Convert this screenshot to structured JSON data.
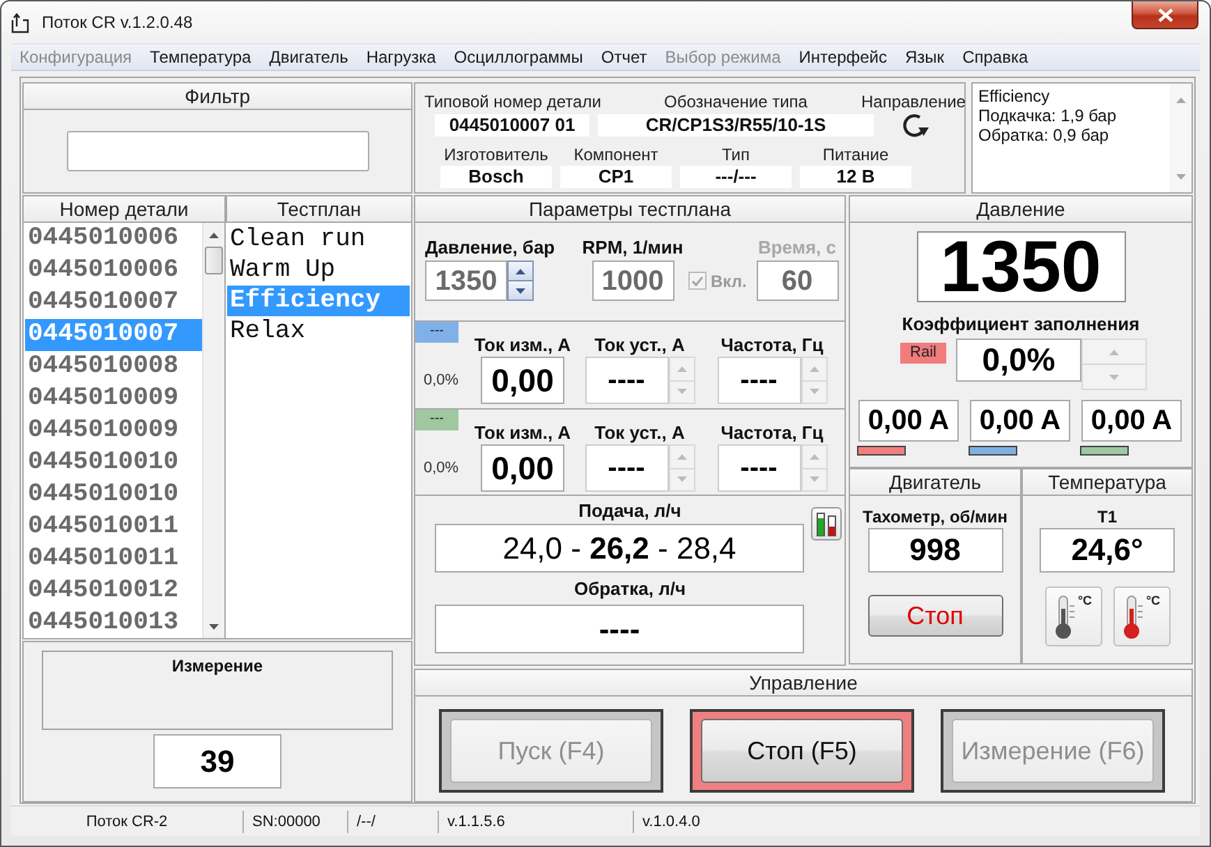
{
  "window": {
    "title": "Поток CR v.1.2.0.48"
  },
  "menu": [
    {
      "label": "Конфигурация",
      "disabled": true
    },
    {
      "label": "Температура",
      "disabled": false
    },
    {
      "label": "Двигатель",
      "disabled": false
    },
    {
      "label": "Нагрузка",
      "disabled": false
    },
    {
      "label": "Осциллограммы",
      "disabled": false
    },
    {
      "label": "Отчет",
      "disabled": false
    },
    {
      "label": "Выбор режима",
      "disabled": true
    },
    {
      "label": "Интерфейс",
      "disabled": false
    },
    {
      "label": "Язык",
      "disabled": false
    },
    {
      "label": "Справка",
      "disabled": false
    }
  ],
  "filter": {
    "title": "Фильтр"
  },
  "part_info": {
    "top": [
      {
        "label": "Типовой номер детали",
        "value": "0445010007 01"
      },
      {
        "label": "Обозначение типа",
        "value": "CR/CP1S3/R55/10-1S"
      }
    ],
    "direction": {
      "label": "Направление"
    },
    "bottom": [
      {
        "label": "Изготовитель",
        "value": "Bosch"
      },
      {
        "label": "Компонент",
        "value": "CP1"
      },
      {
        "label": "Тип",
        "value": "---/---"
      },
      {
        "label": "Питание",
        "value": "12 В"
      }
    ]
  },
  "info_box": {
    "lines": [
      "Efficiency",
      "Подкачка: 1,9 бар",
      "Обратка: 0,9 бар"
    ]
  },
  "part_numbers": {
    "title": "Номер детали",
    "items": [
      {
        "label": "0445010006",
        "selected": false
      },
      {
        "label": "0445010006",
        "selected": false
      },
      {
        "label": "0445010007",
        "selected": false
      },
      {
        "label": "0445010007",
        "selected": true
      },
      {
        "label": "0445010008",
        "selected": false
      },
      {
        "label": "0445010009",
        "selected": false
      },
      {
        "label": "0445010009",
        "selected": false
      },
      {
        "label": "0445010010",
        "selected": false
      },
      {
        "label": "0445010010",
        "selected": false
      },
      {
        "label": "0445010011",
        "selected": false
      },
      {
        "label": "0445010011",
        "selected": false
      },
      {
        "label": "0445010012",
        "selected": false
      },
      {
        "label": "0445010013",
        "selected": false
      }
    ]
  },
  "testplans": {
    "title": "Тестплан",
    "items": [
      {
        "label": "Clean run",
        "selected": false
      },
      {
        "label": "Warm Up",
        "selected": false
      },
      {
        "label": "Efficiency",
        "selected": true
      },
      {
        "label": "Relax",
        "selected": false
      }
    ]
  },
  "measurement": {
    "title": "Измерение",
    "value": "39"
  },
  "params": {
    "title": "Параметры тестплана",
    "settings": [
      {
        "kind": "spin",
        "label": "Давление, бар",
        "value": "1350",
        "disabled": false
      },
      {
        "kind": "plain",
        "label": "RPM, 1/мин",
        "value": "1000",
        "disabled": false
      },
      {
        "kind": "check",
        "label": "Вкл.",
        "checked": true,
        "disabled": true
      },
      {
        "kind": "plain",
        "label": "Время, с",
        "value": "60",
        "disabled": true
      }
    ],
    "channels": [
      {
        "tag": "---",
        "color": "#80b0e8",
        "duty": "0,0%",
        "fields": [
          {
            "kind": "plain",
            "label": "Ток изм., А",
            "value": "0,00"
          },
          {
            "kind": "spin",
            "label": "Ток уст., А",
            "value": "----",
            "disabled": true
          },
          {
            "kind": "spin",
            "label": "Частота, Гц",
            "value": "----",
            "disabled": true
          }
        ]
      },
      {
        "tag": "---",
        "color": "#a0c8a0",
        "duty": "0,0%",
        "fields": [
          {
            "kind": "plain",
            "label": "Ток изм., А",
            "value": "0,00"
          },
          {
            "kind": "spin",
            "label": "Ток уст., А",
            "value": "----",
            "disabled": true
          },
          {
            "kind": "spin",
            "label": "Частота, Гц",
            "value": "----",
            "disabled": true
          }
        ]
      }
    ]
  },
  "flow": {
    "supply": {
      "label": "Подача, л/ч",
      "value": "24,0 - **26,2** - 28,4"
    },
    "return": {
      "label": "Обратка, л/ч",
      "value": "----"
    }
  },
  "pressure": {
    "title": "Давление",
    "value": "1350",
    "duty_label": "Коэффициент заполнения",
    "duty": {
      "tag": "Rail",
      "value": "0,0%",
      "disabled": true
    },
    "currents": [
      {
        "value": "0,00 A",
        "color": "#f08080"
      },
      {
        "value": "0,00 A",
        "color": "#80b0e0"
      },
      {
        "value": "0,00 A",
        "color": "#a0c8a0"
      }
    ]
  },
  "engine": {
    "title": "Двигатель",
    "tacho_label": "Тахометр, об/мин",
    "tacho": "998",
    "stop_button": "Стоп"
  },
  "temperature": {
    "title": "Температура",
    "sensor": "T1",
    "value": "24,6°",
    "buttons": [
      {
        "unit": "°C",
        "color": "#555555"
      },
      {
        "unit": "°C",
        "color": "#d42020"
      }
    ]
  },
  "control": {
    "title": "Управление",
    "buttons": [
      {
        "label": "Пуск (F4)",
        "disabled": true,
        "active": false
      },
      {
        "label": "Стоп (F5)",
        "disabled": false,
        "active": true
      },
      {
        "label": "Измерение (F6)",
        "disabled": true,
        "active": false
      }
    ]
  },
  "status_bar": [
    "Поток CR-2",
    "SN:00000",
    "/--/",
    "v.1.1.5.6",
    "v.1.0.4.0"
  ]
}
